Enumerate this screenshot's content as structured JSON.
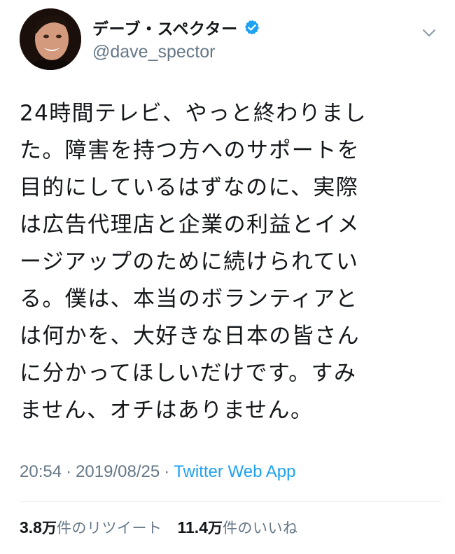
{
  "user": {
    "display_name": "デーブ・スペクター",
    "handle": "@dave_spector",
    "verified": true,
    "avatar_icon": "avatar-photo"
  },
  "tweet": {
    "text": "24時間テレビ、やっと終わりまし\nた。障害を持つ方へのサポートを\n目的にしているはずなのに、実際\nは広告代理店と企業の利益とイメ\nージアップのために続けられてい\nる。僕は、本当のボランティアと\nは何かを、大好きな日本の皆さん\nに分かってほしいだけです。すみ\nません、オチはありません。",
    "time": "20:54",
    "date": "2019/08/25",
    "separator": "·",
    "source": "Twitter Web App"
  },
  "stats": {
    "retweets": {
      "number": "3.8",
      "unit": "万",
      "label": "件のリツイート"
    },
    "likes": {
      "number": "11.4",
      "unit": "万",
      "label": "件のいいね"
    }
  },
  "icons": {
    "verified": "verified-badge-icon",
    "menu": "chevron-down-icon"
  },
  "colors": {
    "text_primary": "#14171a",
    "text_secondary": "#657786",
    "link": "#1da1f2",
    "verified": "#1da1f2",
    "divider": "#e1e8ed"
  }
}
